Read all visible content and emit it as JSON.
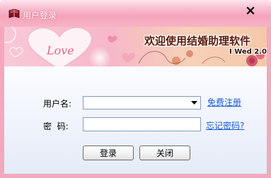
{
  "window": {
    "title": "用户登录",
    "title_icon": "book-icon",
    "close_icon": "close-icon"
  },
  "banner": {
    "headline": "欢迎使用结婚助理软件",
    "subtitle": "I Wed 2.0",
    "decoration_text": "Love"
  },
  "form": {
    "username_label": "用户名:",
    "username_value": "",
    "username_dropdown_icon": "chevron-down-icon",
    "password_label": "密  码:",
    "password_value": "",
    "register_link": "免费注册",
    "forgot_link": "忘记密码?"
  },
  "buttons": {
    "login_label": "登录",
    "close_label": "关闭"
  },
  "colors": {
    "frame": "#f5a8bc",
    "link": "#1c5bd6",
    "content_bg": "#eef2fb"
  }
}
